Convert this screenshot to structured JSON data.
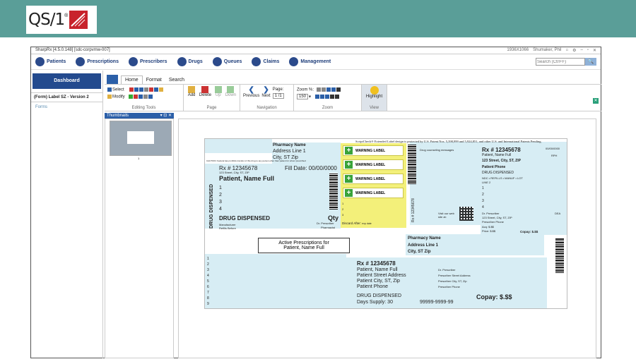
{
  "logo": {
    "text": "QS/1",
    "reg": "®"
  },
  "window": {
    "title": "SharpRx  [4.5.0.148]  [sdc-corpvmw-007]",
    "resolution": "1936X1066",
    "user": "Shumaker, Phil"
  },
  "nav": {
    "items": [
      {
        "label": "Patients",
        "icon": "patients-icon"
      },
      {
        "label": "Prescriptions",
        "icon": "prescriptions-icon"
      },
      {
        "label": "Prescribers",
        "icon": "prescribers-icon"
      },
      {
        "label": "Drugs",
        "icon": "drugs-icon"
      },
      {
        "label": "Queues",
        "icon": "queues-icon"
      },
      {
        "label": "Claims",
        "icon": "claims-icon"
      },
      {
        "label": "Management",
        "icon": "management-icon"
      }
    ],
    "search_placeholder": "Search (Ctrl+F)"
  },
  "left": {
    "dashboard": "Dashboard",
    "form_title": "(Form) Label SZ - Version 2",
    "forms": "Forms"
  },
  "tabs": [
    "Home",
    "Format",
    "Search"
  ],
  "ribbon": {
    "select": "Select",
    "modify": "Modify",
    "editing_tools": "Editing Tools",
    "add": "Add",
    "delete": "Delete",
    "up": "Up",
    "down": "Down",
    "page": "Page",
    "previous": "Previous",
    "next": "Next",
    "page_label": "Page:",
    "page_value": "1 /1",
    "navigation": "Navigation",
    "zoom_label": "Zoom %:",
    "zoom_value": "150",
    "zoom": "Zoom",
    "highlight": "Highlight",
    "view": "View"
  },
  "thumbnails": {
    "title": "Thumbnails",
    "page_num": "1"
  },
  "label": {
    "scriptcheck": "ScriptCheck® Extended Label design is protected by U.S. Patent Nos. 5,398,999 and 5,924,851, and other U.S. and International Patents Pending.",
    "pharmacy_name": "Pharmacy Name",
    "address_line": "Address Line 1",
    "city_state": "City, ST Zip",
    "caution": "CAUTION: Federal law prohibits transfer of this drug to any person other than patient for whom prescribed",
    "rx": "Rx # 12345678",
    "fill_date": "Fill Date: 00/00/0000",
    "patient_addr": "123 Street, City, ST, ZIP",
    "patient_name": "Patient, Name Full",
    "nums": [
      "1",
      "2",
      "3",
      "4"
    ],
    "drug_dispensed": "DRUG DISPENSED",
    "qty": "Qty",
    "dr_prescriber": "Dr. Prescriber",
    "manufacturer": "Manufacturer",
    "pharmacist": "Pharmacist",
    "refills_before": "Refills Before",
    "warning_label": "WARNING LABEL",
    "discard_after": "Discard After:",
    "exp_date": "exp date",
    "rx_vertical": "Rx # 12345678",
    "drug_counseling": "Drug counseling messages",
    "visit_web": "Visit our web site at:",
    "right_rx": "Rx # 12345678",
    "right_date": "00/00/0000",
    "rph": "RPH",
    "right_patient": "Patient, Name Full",
    "right_street": "123 Street, City, ST, ZIP",
    "patient_phone": "Patient Phone",
    "right_drug": "DRUG DISPENSED",
    "ndc_line": "NDC • REFILLS • MANUF • LOT",
    "line2": "LINE 2",
    "right_nums": [
      "1",
      "2",
      "3",
      "4"
    ],
    "dea": "DEA",
    "prescriber_street": "123 Street, City, ST, ZIP",
    "prescriber_phone": "Prescriber Phone",
    "acq": "Acq:  $.$$",
    "price": "Price:  $.$$",
    "copay_small": "Copay:  $.$$",
    "active_title": "Active Prescriptions for",
    "active_name": "Patient, Name Full",
    "ph2_name": "Pharmacy Name",
    "ph2_addr": "Address Line 1",
    "ph2_city": "City, ST Zip",
    "bottom_nums": [
      "1",
      "2",
      "3",
      "4",
      "5",
      "6",
      "7",
      "8",
      "9"
    ],
    "b_rx": "Rx # 12345678",
    "b_patient": "Patient, Name Full",
    "b_street": "Patient Street Address",
    "b_city": "Patient City, ST, Zip",
    "b_phone": "Patient Phone",
    "b_dr": "Dr. Prescriber",
    "b_pstreet": "Prescriber Street Address",
    "b_pcity": "Prescriber City, ST, Zip",
    "b_pphone": "Prescriber Phone",
    "b_drug": "DRUG DISPENSED",
    "b_supply": "Days Supply: 30",
    "b_ndc": "99999-9999-99",
    "b_copay": "Copay: $.$$"
  },
  "colors": {
    "banner": "#5a9e98",
    "nav_blue": "#2b4a8b",
    "label_blue": "#d7edf4",
    "warning_yellow": "#f3f07a"
  }
}
